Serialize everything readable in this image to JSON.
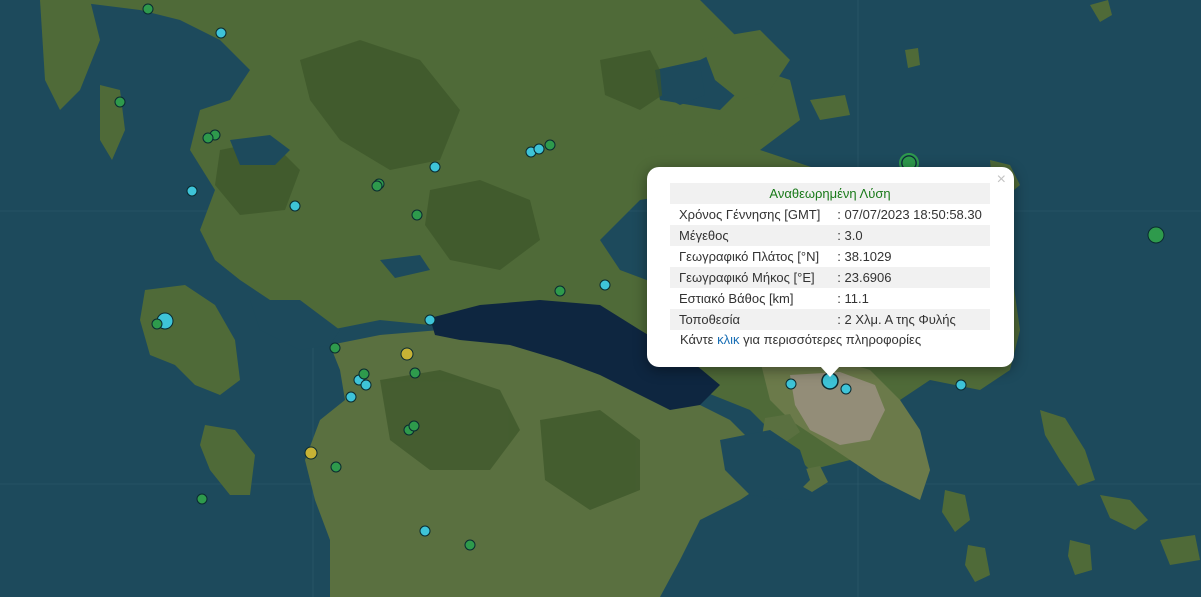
{
  "popup": {
    "title": "Αναθεωρημένη Λύση",
    "rows": [
      {
        "label": "Χρόνος Γέννησης [GMT]",
        "value": ": 07/07/2023 18:50:58.30"
      },
      {
        "label": "Μέγεθος",
        "value": ": 3.0"
      },
      {
        "label": "Γεωγραφικό Πλάτος [°N]",
        "value": ": 38.1029"
      },
      {
        "label": "Γεωγραφικό Μήκος [°E]",
        "value": ": 23.6906"
      },
      {
        "label": "Εστιακό Βάθος [km]",
        "value": ": 11.1"
      },
      {
        "label": "Τοποθεσία",
        "value": ": 2 Χλμ. Α της Φυλής"
      }
    ],
    "footer_prefix": "Κάντε",
    "footer_link": "κλικ",
    "footer_suffix": "για περισσότερες πληροφορίες",
    "close_symbol": "×"
  },
  "colors": {
    "sea": "#1d4a5c",
    "deep_gulf": "#0e2640",
    "land": "#4f6a38",
    "mountain": "#3c5529",
    "lowland": "#6b7a4a",
    "urban": "#9a9080",
    "quake_cyan": "#3ec4d8",
    "quake_green": "#2e9a4c",
    "quake_yellow": "#c7b335",
    "marker_stroke": "#0a2a30",
    "popup_title": "#1a7a1a",
    "link": "#1a6fb5"
  }
}
